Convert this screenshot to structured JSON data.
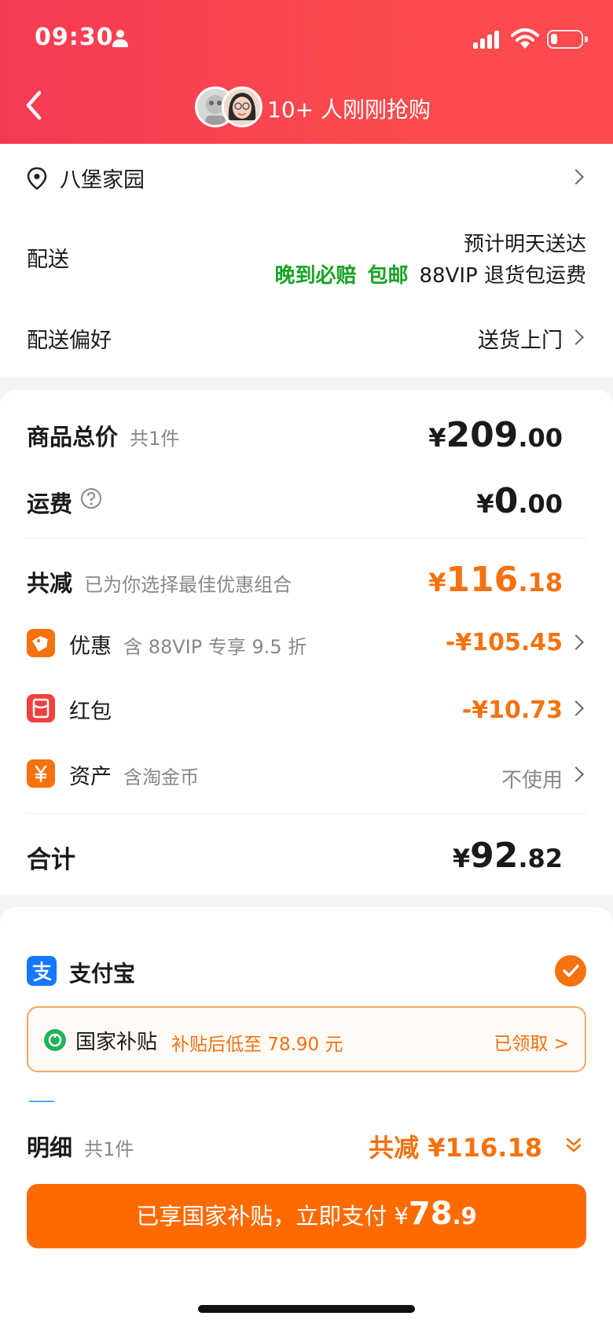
{
  "status_bar": {
    "time": "09:30"
  },
  "header": {
    "title": "10+ 人刚刚抢购"
  },
  "address": {
    "name": "八堡家园"
  },
  "delivery": {
    "label": "配送",
    "estimate": "预计明天送达",
    "tag_late": "晚到必赔",
    "tag_free": "包邮",
    "tag_return": "88VIP 退货包运费"
  },
  "preference": {
    "label": "配送偏好",
    "value": "送货上门"
  },
  "summary": {
    "goods_label": "商品总价",
    "goods_count": "共1件",
    "goods_price": {
      "cur": "¥",
      "int": "209",
      "dec": ".00"
    },
    "shipping_label": "运费",
    "shipping_price": {
      "cur": "¥",
      "int": "0",
      "dec": ".00"
    },
    "reduce_label": "共减",
    "reduce_note": "已为你选择最佳优惠组合",
    "reduce_price": {
      "cur": "¥",
      "int": "116",
      "dec": ".18"
    },
    "items": [
      {
        "label": "优惠",
        "note": "含 88VIP 专享 9.5 折",
        "value": "-¥105.45"
      },
      {
        "label": "红包",
        "note": "",
        "value": "-¥10.73"
      },
      {
        "label": "资产",
        "note": "含淘金币",
        "value": "不使用"
      }
    ],
    "total_label": "合计",
    "total_price": {
      "cur": "¥",
      "int": "92",
      "dec": ".82"
    }
  },
  "payment": {
    "method": "支付宝",
    "subsidy_label": "国家补贴",
    "subsidy_note": "补贴后低至 78.90 元",
    "subsidy_status": "已领取 >"
  },
  "bottom": {
    "detail_label": "明细",
    "detail_count": "共1件",
    "reduce_total": "共减 ¥116.18",
    "pay_text": "已享国家补贴，立即支付 ¥",
    "pay_int": "78",
    "pay_dec": ".9"
  },
  "colors": {
    "header_red": "#f73a54",
    "accent_orange": "#f5720f",
    "green": "#18a325",
    "button_orange": "#ff6a00"
  }
}
